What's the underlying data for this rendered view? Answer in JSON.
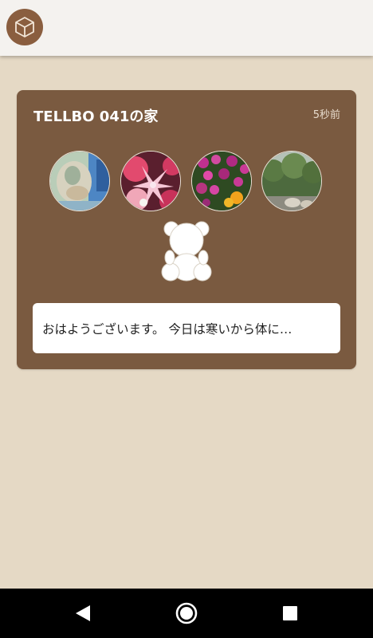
{
  "app": {
    "icon": "cube-icon"
  },
  "card": {
    "title": "TELLBO 041の家",
    "time": "5秒前",
    "photos": [
      {
        "name": "photo-1",
        "icon": "photo-thumbnail"
      },
      {
        "name": "photo-2",
        "icon": "photo-thumbnail"
      },
      {
        "name": "photo-3",
        "icon": "photo-thumbnail"
      },
      {
        "name": "photo-4",
        "icon": "photo-thumbnail"
      }
    ],
    "mascot_icon": "teddy-bear-icon",
    "message": "おはようございます。 今日は寒いから体に…"
  },
  "nav": {
    "back_icon": "back-triangle-icon",
    "home_icon": "home-circle-icon",
    "recents_icon": "recents-square-icon"
  },
  "colors": {
    "background": "#e5d9c5",
    "card": "#7a5a40",
    "top_bar": "#f4f2ef",
    "app_icon": "#8a5e3f"
  }
}
